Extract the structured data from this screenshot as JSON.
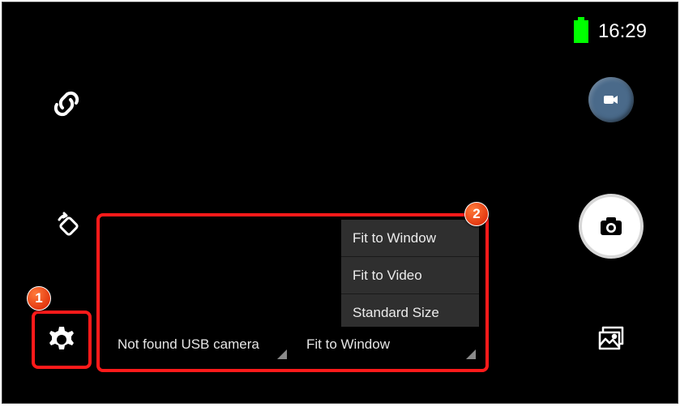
{
  "status": {
    "time": "16:29"
  },
  "badges": {
    "one": "1",
    "two": "2"
  },
  "spinner_left": {
    "text": "Not found USB camera"
  },
  "spinner_right": {
    "text": "Fit to Window"
  },
  "dropdown": {
    "items": [
      {
        "label": "Fit to Window"
      },
      {
        "label": "Fit to Video"
      },
      {
        "label": "Standard Size"
      }
    ]
  }
}
